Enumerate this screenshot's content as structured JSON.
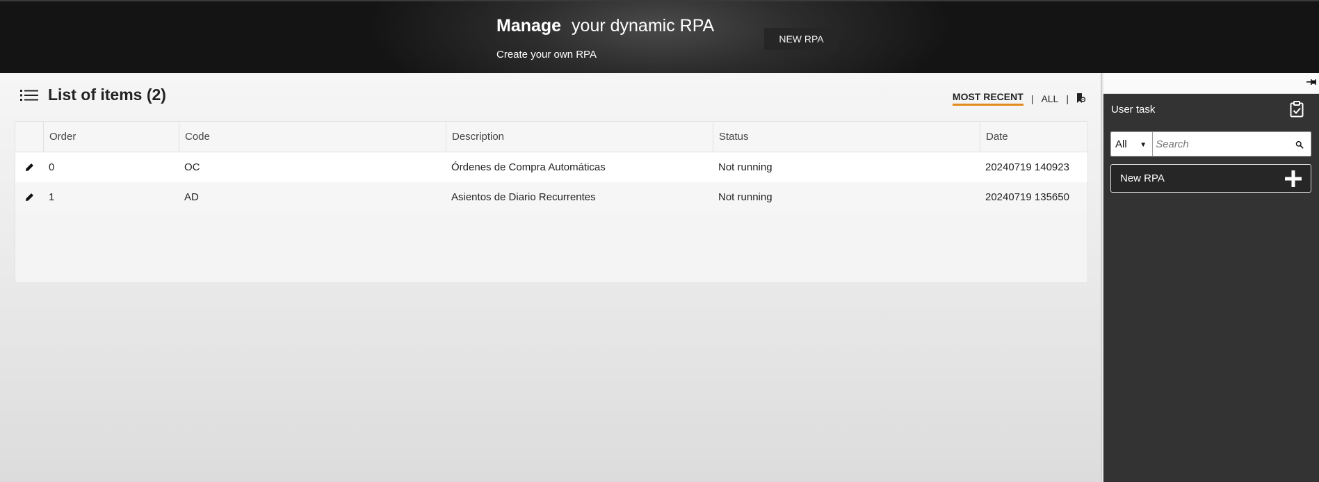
{
  "banner": {
    "title_bold": "Manage",
    "title_rest": "your dynamic RPA",
    "subtitle": "Create your own RPA",
    "new_button_label": "NEW RPA"
  },
  "list": {
    "title": "List of items (2)",
    "filters": {
      "most_recent": "MOST RECENT",
      "separator": "|",
      "all": "ALL"
    },
    "columns": [
      "Order",
      "Code",
      "Description",
      "Status",
      "Date"
    ],
    "rows": [
      {
        "order": "0",
        "code": "OC",
        "description": "Órdenes de Compra Automáticas",
        "status": "Not running",
        "date": "20240719 140923"
      },
      {
        "order": "1",
        "code": "AD",
        "description": "Asientos de Diario Recurrentes",
        "status": "Not running",
        "date": "20240719 135650"
      }
    ]
  },
  "side_panel": {
    "title": "User task",
    "filter_select_value": "All",
    "search_placeholder": "Search",
    "items": [
      {
        "label": "New RPA"
      }
    ]
  },
  "colors": {
    "accent_underline": "#e38a1c",
    "panel_bg": "#333333",
    "banner_bg": "#1e1e1e"
  },
  "icons": {
    "list": "list-icon",
    "edit": "pencil-icon",
    "filter_extra": "bookmark-gear-icon",
    "pin": "pin-icon",
    "clipboard": "clipboard-check-icon",
    "search": "search-icon",
    "add": "plus-icon"
  }
}
